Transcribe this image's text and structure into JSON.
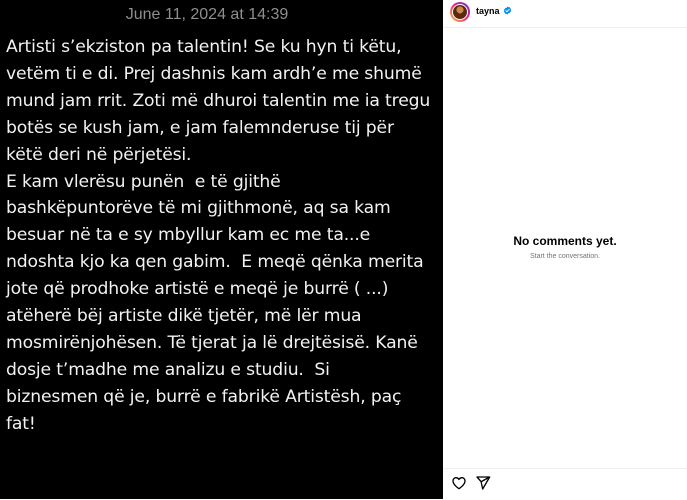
{
  "post": {
    "date": "June 11, 2024 at 14:39",
    "lines": [
      "Artisti s’ekziston pa talentin! Se ku hyn ti këtu,",
      "vetëm ti e di. Prej dashnis kam ardh’e me shumë",
      "mund jam rrit. Zoti më dhuroi talentin me ia tregu",
      "botës se kush jam, e jam falemnderuse tij për",
      "këtë deri në përjetësi.",
      "E kam vlerësu punën  e të gjithë",
      "bashkëpuntorëve të mi gjithmonë, aq sa kam",
      "besuar në ta e sy mbyllur kam ec me ta...e",
      "ndoshta kjo ka qen gabim.  E meqë qënka merita",
      "jote që prodhoke artistë e meqë je burrë ( ...)",
      "atëherë bëj artiste dikë tjetër, më lër mua",
      "mosmirënjohësen. Të tjerat ja lë drejtësisë. Kanë",
      "dosje t’madhe me analizu e studiu.  Si",
      "biznesmen që je, burrë e fabrikë Artistësh, paç",
      "fat!"
    ]
  },
  "sidebar": {
    "username": "tayna",
    "empty_title": "No comments yet.",
    "empty_subtitle": "Start the conversation."
  },
  "icons": {
    "verified": "verified-badge-icon",
    "like": "heart-icon",
    "share": "paper-plane-icon"
  },
  "colors": {
    "verified": "#0095f6",
    "post_background": "#000000",
    "date_text": "#8e8e93"
  }
}
